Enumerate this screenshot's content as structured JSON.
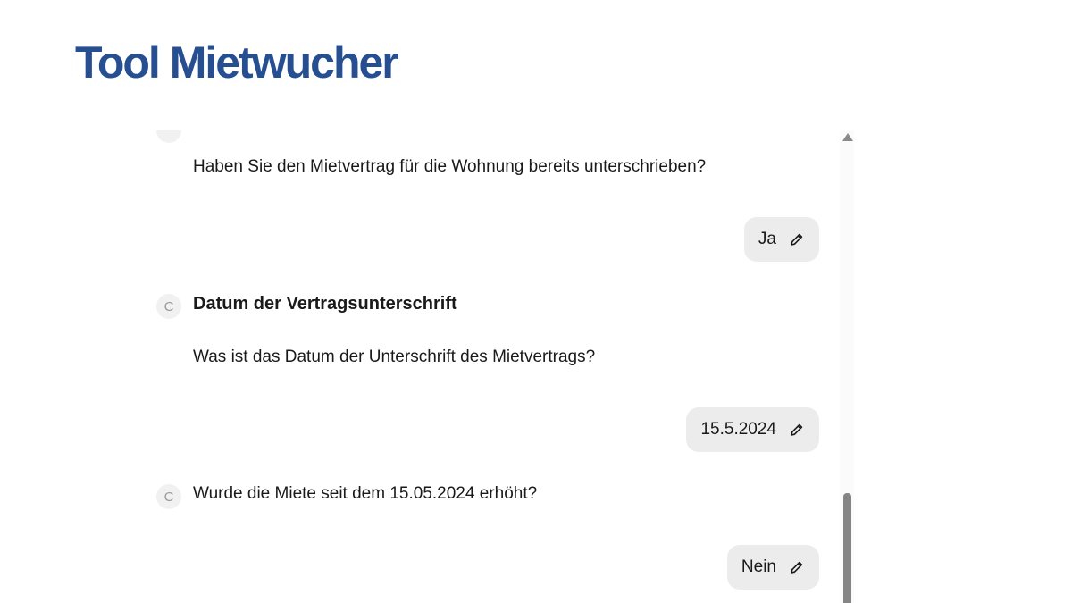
{
  "header": {
    "title": "Tool Mietwucher"
  },
  "chat": {
    "messages": [
      {
        "avatar_letter": "",
        "title": "",
        "question": "Haben Sie den Mietvertrag für die Wohnung bereits unterschrieben?",
        "answer": "Ja"
      },
      {
        "avatar_letter": "C",
        "title": "Datum der Vertragsunterschrift",
        "question": "Was ist das Datum der Unterschrift des Mietvertrags?",
        "answer": "15.5.2024"
      },
      {
        "avatar_letter": "C",
        "title": "",
        "question": "Wurde die Miete seit dem 15.05.2024 erhöht?",
        "answer": "Nein"
      }
    ],
    "edit_icon": "pencil-icon"
  },
  "colors": {
    "title": "#264f91",
    "bubble": "#ececec",
    "avatar_bg": "#f1f1f1",
    "scroll_thumb": "#858585"
  }
}
